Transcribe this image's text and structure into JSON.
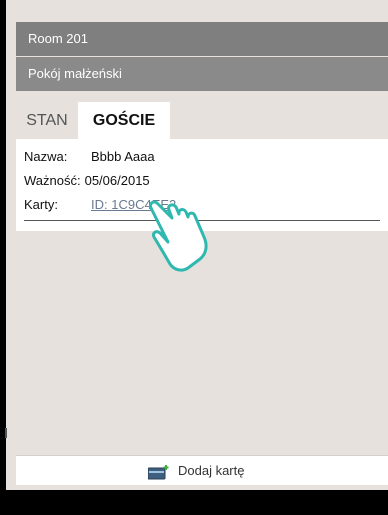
{
  "header": {
    "room_title": "Room 201",
    "room_type": "Pokój małżeński"
  },
  "tabs": [
    {
      "label": "STAN",
      "selected": false
    },
    {
      "label": "GOŚCIE",
      "selected": true
    }
  ],
  "guest": {
    "name_label": "Nazwa:",
    "name_value": "Bbbb Aaaa",
    "validity_label": "Ważność:",
    "validity_value": "05/06/2015",
    "cards_label": "Karty:",
    "card_link": "ID: 1C9C4EE2"
  },
  "footer": {
    "add_card_label": "Dodaj kartę",
    "add_card_icon": "card-plus-icon"
  },
  "colors": {
    "background": "#e6e1dd",
    "header_bar": "#7f7f7f",
    "subheader_bar": "#8a8a8a",
    "link": "#6a7a8f",
    "pointer_accent": "#2fb8b0"
  }
}
